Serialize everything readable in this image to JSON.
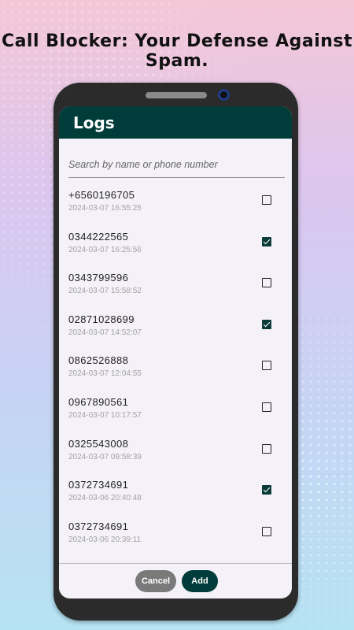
{
  "headline": "Call Blocker: Your Defense Against Spam.",
  "app": {
    "title": "Logs",
    "search_placeholder": "Search by name or phone number"
  },
  "logs": [
    {
      "number": "+6560196705",
      "time": "2024-03-07 16:55:25",
      "checked": false
    },
    {
      "number": "0344222565",
      "time": "2024-03-07 16:25:56",
      "checked": true
    },
    {
      "number": "0343799596",
      "time": "2024-03-07 15:58:52",
      "checked": false
    },
    {
      "number": "02871028699",
      "time": "2024-03-07 14:52:07",
      "checked": true
    },
    {
      "number": "0862526888",
      "time": "2024-03-07 12:04:55",
      "checked": false
    },
    {
      "number": "0967890561",
      "time": "2024-03-07 10:17:57",
      "checked": false
    },
    {
      "number": "0325543008",
      "time": "2024-03-07 09:58:39",
      "checked": false
    },
    {
      "number": "0372734691",
      "time": "2024-03-06 20:40:48",
      "checked": true
    },
    {
      "number": "0372734691",
      "time": "2024-03-06 20:39:11",
      "checked": false
    }
  ],
  "buttons": {
    "cancel": "Cancel",
    "add": "Add"
  },
  "colors": {
    "accent": "#003d3a",
    "cancel": "#7a7a7a"
  }
}
